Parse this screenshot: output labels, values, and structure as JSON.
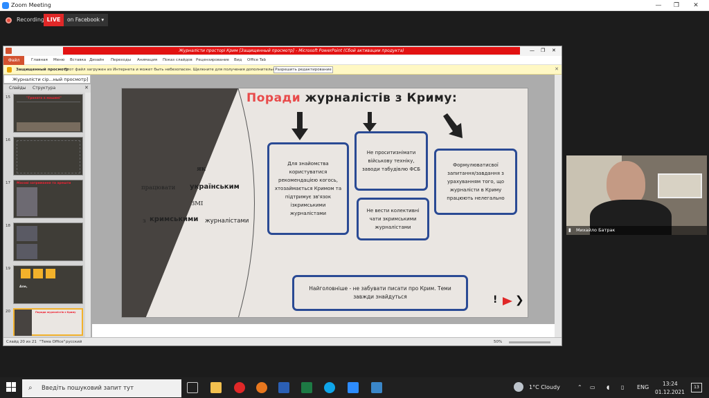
{
  "zoom": {
    "title": "Zoom Meeting",
    "recording": "Recording",
    "live": "LIVE",
    "live_target": "on Facebook",
    "participant_name": "Михайло Батрак"
  },
  "ppt": {
    "title_bar": "Журналісти просторі Крим [Защищенный просмотр] - Microsoft PowerPoint (Сбой активации продукта)",
    "file_tab": "Файл",
    "ribbon_tabs": [
      "Главная",
      "Меню",
      "Вставка",
      "Дизайн",
      "Переходы",
      "Анимация",
      "Показ слайдов",
      "Рецензирование",
      "Вид",
      "Office Tab"
    ],
    "msg_bold": "Защищенный просмотр",
    "msg_text": "Этот файл загружен из Интернета и может быть небезопасен. Щелкните для получения дополнительных сведений.",
    "edit_button": "Разрешить редактирование",
    "doc_tab": "Журналісти сір...ный просмотр]",
    "panel_tab_slides": "Слайды",
    "panel_tab_structure": "Структура",
    "thumbs": [
      {
        "num": "15",
        "title": "\"Граната в машині\""
      },
      {
        "num": "16",
        "title": ""
      },
      {
        "num": "17",
        "title": "Масові затримання та арешти"
      },
      {
        "num": "18",
        "title": ""
      },
      {
        "num": "19",
        "title": "Але,"
      },
      {
        "num": "20",
        "title": "Поради журналістів з Криму"
      }
    ],
    "status_slide": "Слайд 20 из 21",
    "status_theme": "\"Тема Office\"",
    "status_lang": "русский",
    "zoom_level": "50%"
  },
  "slide": {
    "title_red": "Поради",
    "title_rest": " журналістів з Криму:",
    "left_line1": "як",
    "left_line2a": "працювати",
    "left_line2b": "українським",
    "left_line3": "ЗМІ",
    "left_line4a": "з",
    "left_line4b": "кримськими",
    "left_line4c": "журналістами",
    "box1": "Для знайомства користуватися рекомендацією когось, хтозаймається Кримом та підтримує зв'язок ізкримськими журналістами",
    "box2": "Не проситизнімати військову техніку, заводи табудівлю ФСБ",
    "box3": "Не вести колективні чати зкримськими журналістами",
    "box4": "Формулюватисвої запитання/завдання з урахуванням того, що журналісти в Криму працюють нелегально",
    "box5": "Найголовніше - не забувати писати про Крим. Теми завжди знайдуться"
  },
  "taskbar": {
    "search_placeholder": "Введіть пошуковий запит тут",
    "weather": "1°C  Cloudy",
    "lang": "ENG",
    "time": "13:24",
    "date": "01.12.2021",
    "notifications": "13"
  }
}
